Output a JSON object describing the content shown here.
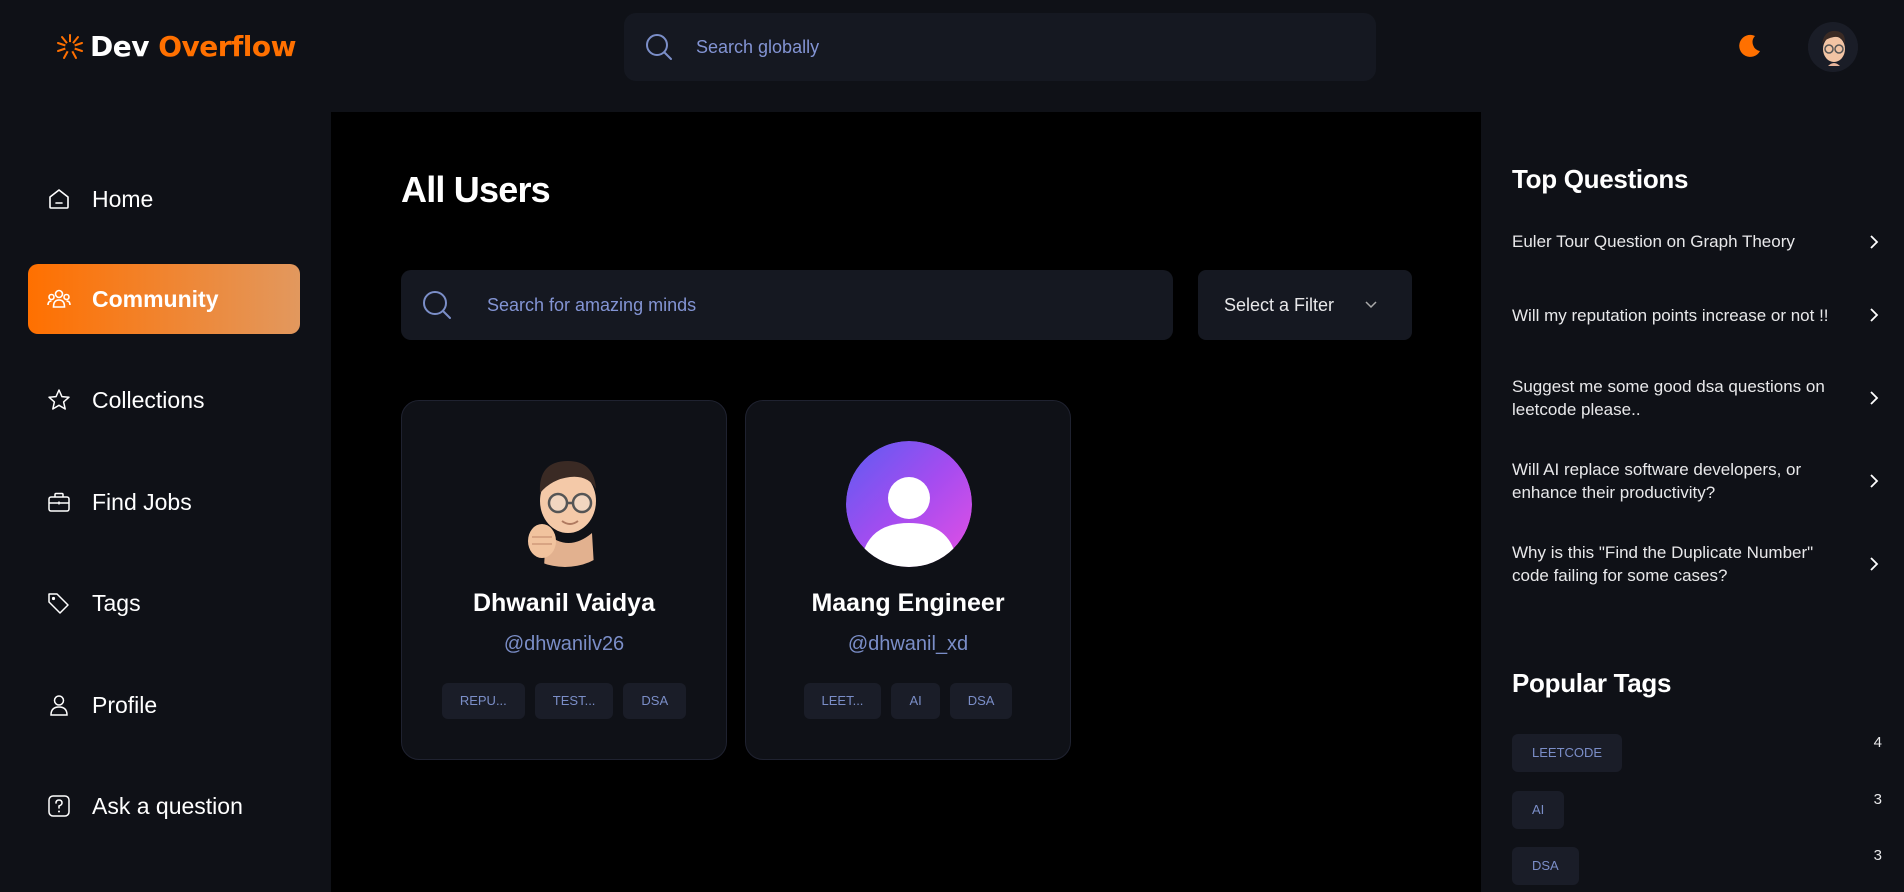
{
  "brand": {
    "word1": "Dev",
    "word2": "Overflow",
    "accent": "#ff7000"
  },
  "global_search": {
    "placeholder": "Search globally",
    "icon": "search-icon"
  },
  "header": {
    "theme_icon": "moon-icon",
    "avatar": "avatar"
  },
  "sidebar": {
    "items": [
      {
        "label": "Home",
        "icon": "home-icon",
        "active": false
      },
      {
        "label": "Community",
        "icon": "users-icon",
        "active": true
      },
      {
        "label": "Collections",
        "icon": "star-icon",
        "active": false
      },
      {
        "label": "Find Jobs",
        "icon": "briefcase-icon",
        "active": false
      },
      {
        "label": "Tags",
        "icon": "tag-icon",
        "active": false
      },
      {
        "label": "Profile",
        "icon": "user-icon",
        "active": false
      },
      {
        "label": "Ask a question",
        "icon": "question-icon",
        "active": false
      }
    ]
  },
  "main": {
    "title": "All Users",
    "search": {
      "placeholder": "Search for amazing minds"
    },
    "filter": {
      "label": "Select a Filter"
    },
    "users": [
      {
        "name": "Dhwanil Vaidya",
        "username": "@dhwanilv26",
        "tags": [
          "REPU...",
          "TEST...",
          "DSA"
        ]
      },
      {
        "name": "Maang Engineer",
        "username": "@dhwanil_xd",
        "tags": [
          "LEET...",
          "AI",
          "DSA"
        ]
      }
    ]
  },
  "right_sidebar": {
    "top_questions_title": "Top Questions",
    "questions": [
      "Euler Tour Question on Graph Theory",
      "Will my reputation points increase or not !!",
      "Suggest me some good dsa questions on leetcode please..",
      "Will AI replace software developers, or enhance their productivity?",
      "Why is this \"Find the Duplicate Number\" code failing for some cases?"
    ],
    "popular_tags_title": "Popular Tags",
    "tags": [
      {
        "name": "LEETCODE",
        "count": "4"
      },
      {
        "name": "AI",
        "count": "3"
      },
      {
        "name": "DSA",
        "count": "3"
      }
    ]
  }
}
